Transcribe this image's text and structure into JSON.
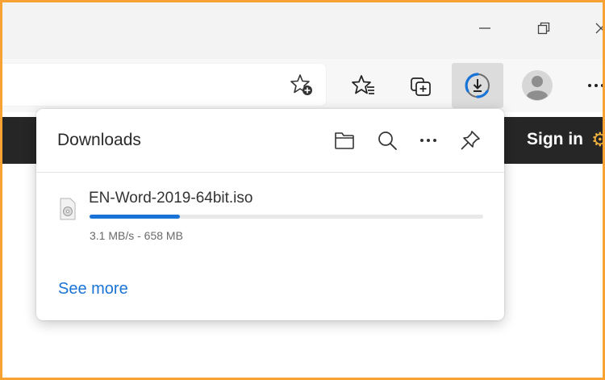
{
  "browser": {
    "icons": [
      "minimize-icon",
      "restore-icon",
      "close-icon",
      "add-favorite-icon",
      "favorites-icon",
      "collections-icon",
      "downloads-icon",
      "profile-icon",
      "settings-more-icon"
    ]
  },
  "site": {
    "sign_in_label": "Sign in"
  },
  "downloads_panel": {
    "title": "Downloads",
    "header_icons": [
      "open-folder-icon",
      "search-icon",
      "more-options-icon",
      "pin-icon"
    ],
    "items": [
      {
        "file_name": "EN-Word-2019-64bit.iso",
        "status": "3.1 MB/s - 658 MB",
        "progress": 0.23
      }
    ],
    "see_more_label": "See more"
  },
  "colors": {
    "accent": "#1a73d6",
    "frame_border": "#f7a233",
    "site_bar": "#262626"
  }
}
